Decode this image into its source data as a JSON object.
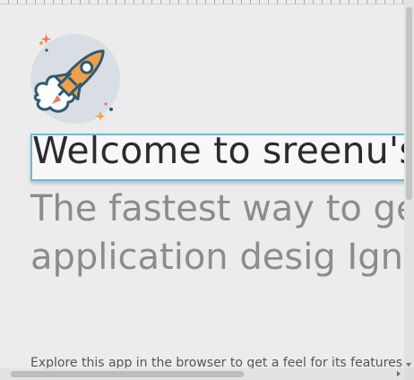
{
  "welcome": {
    "title": "Welcome to sreenu's",
    "subtitle": "The fastest way to ge with application desig Ignition.",
    "body": "Explore this app in the browser to get a feel for its features"
  },
  "icons": {
    "hero": "rocket-launch-icon"
  },
  "colors": {
    "focus_border": "#6cbadf",
    "rocket_orange": "#f0a04b",
    "rocket_outline": "#2f5a73",
    "circle_bg": "#d9dee4"
  }
}
